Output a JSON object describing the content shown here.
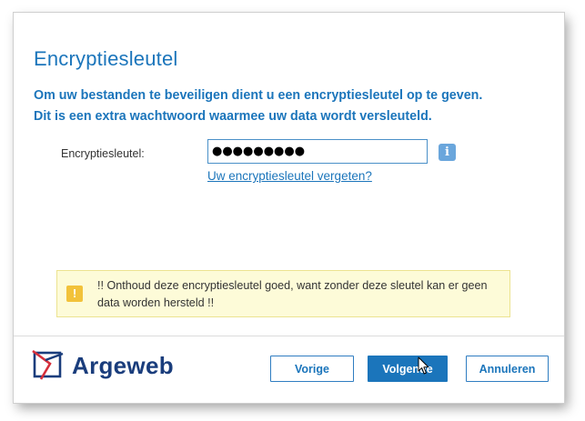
{
  "dialog": {
    "title": "Encryptiesleutel",
    "intro_line1": "Om uw bestanden te beveiligen dient u een encryptiesleutel op te geven.",
    "intro_line2": "Dit is een extra wachtwoord waarmee uw data wordt versleuteld."
  },
  "form": {
    "key_label": "Encryptiesleutel:",
    "key_value": "●●●●●●●●●",
    "info_icon": "info-icon",
    "info_glyph": "i",
    "forgot_link": "Uw encryptiesleutel vergeten?"
  },
  "warning": {
    "icon": "exclamation-icon",
    "glyph": "!",
    "text": "!! Onthoud deze encryptiesleutel goed, want zonder deze sleutel kan er geen data worden hersteld !!"
  },
  "footer": {
    "logo_text": "Argeweb",
    "buttons": {
      "prev": "Vorige",
      "next": "Volgende",
      "cancel": "Annuleren"
    }
  },
  "colors": {
    "accent": "#1b75bb",
    "logo_navy": "#1a3d7c",
    "logo_red": "#d62f3a",
    "warning_bg": "#fdfbd8",
    "warning_icon": "#f2c23a"
  }
}
